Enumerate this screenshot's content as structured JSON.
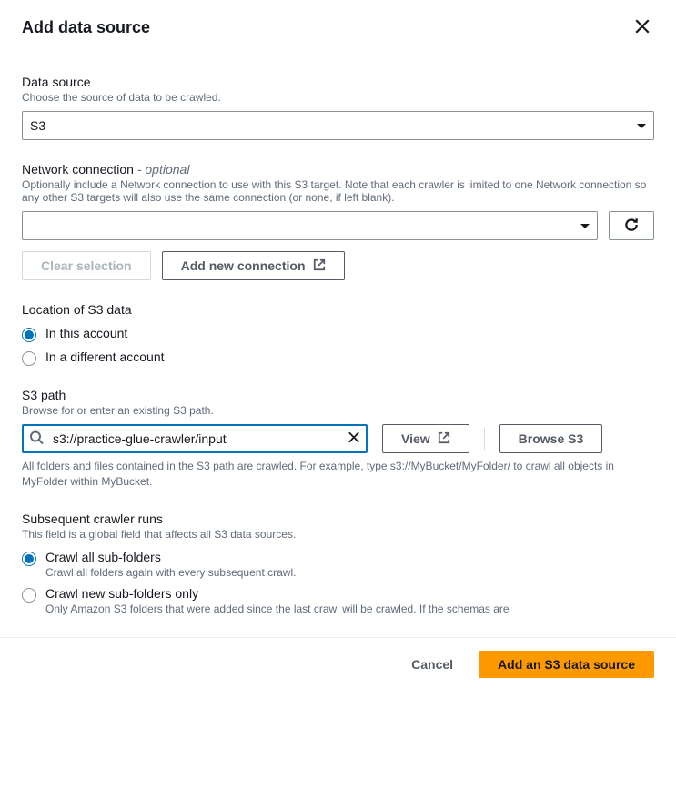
{
  "modal": {
    "title": "Add data source"
  },
  "dataSource": {
    "label": "Data source",
    "description": "Choose the source of data to be crawled.",
    "value": "S3"
  },
  "networkConnection": {
    "label": "Network connection",
    "optional": " - optional",
    "description": "Optionally include a Network connection to use with this S3 target. Note that each crawler is limited to one Network connection so any other S3 targets will also use the same connection (or none, if left blank).",
    "value": "",
    "clearSelectionLabel": "Clear selection",
    "addNewLabel": "Add new connection"
  },
  "locationS3": {
    "label": "Location of S3 data",
    "options": {
      "thisAccount": "In this account",
      "differentAccount": "In a different account"
    }
  },
  "s3Path": {
    "label": "S3 path",
    "description": "Browse for or enter an existing S3 path.",
    "value": "s3://practice-glue-crawler/input",
    "viewLabel": "View",
    "browseLabel": "Browse S3",
    "helper": "All folders and files contained in the S3 path are crawled. For example, type s3://MyBucket/MyFolder/ to crawl all objects in MyFolder within MyBucket."
  },
  "subsequentRuns": {
    "label": "Subsequent crawler runs",
    "description": "This field is a global field that affects all S3 data sources.",
    "crawlAll": {
      "label": "Crawl all sub-folders",
      "description": "Crawl all folders again with every subsequent crawl."
    },
    "crawlNew": {
      "label": "Crawl new sub-folders only",
      "description": "Only Amazon S3 folders that were added since the last crawl will be crawled. If the schemas are"
    }
  },
  "footer": {
    "cancel": "Cancel",
    "submit": "Add an S3 data source"
  }
}
